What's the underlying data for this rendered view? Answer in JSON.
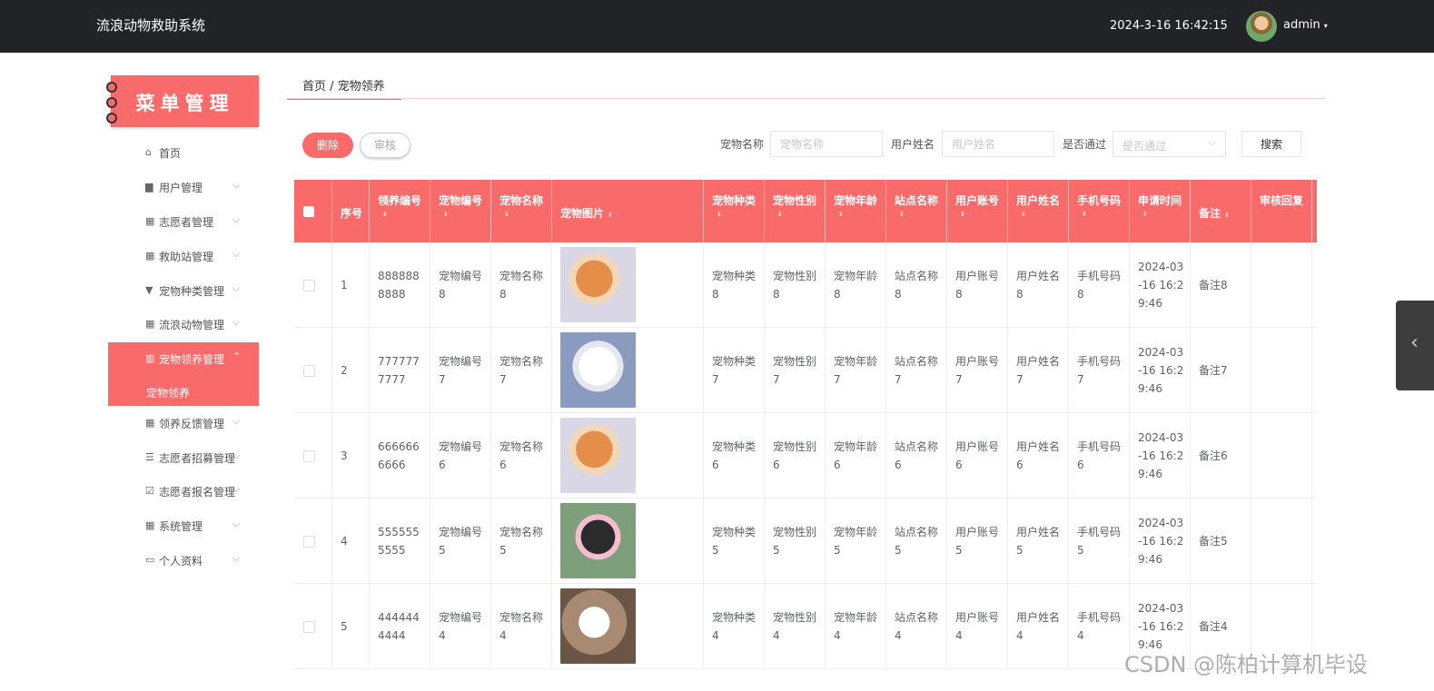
{
  "header": {
    "title": "流浪动物救助系统",
    "datetime": "2024-3-16 16:42:15",
    "username": "admin",
    "caret": "▾"
  },
  "sidebar": {
    "banner": "菜单管理",
    "items": [
      {
        "label": "首页",
        "icon": "⌂",
        "chevron": ""
      },
      {
        "label": "用户管理",
        "icon": "▆",
        "chevron": "⌵"
      },
      {
        "label": "志愿者管理",
        "icon": "▦",
        "chevron": "⌵"
      },
      {
        "label": "救助站管理",
        "icon": "▦",
        "chevron": "⌵"
      },
      {
        "label": "宠物种类管理",
        "icon": "▼",
        "chevron": "⌵"
      },
      {
        "label": "流浪动物管理",
        "icon": "▦",
        "chevron": "⌵"
      },
      {
        "label": "宠物领养管理",
        "icon": "▥",
        "chevron": "⌃"
      },
      {
        "label": "领养反馈管理",
        "icon": "▦",
        "chevron": "⌵"
      },
      {
        "label": "志愿者招募管理",
        "icon": "☰",
        "chevron": "⌵"
      },
      {
        "label": "志愿者报名管理",
        "icon": "☑",
        "chevron": "⌵"
      },
      {
        "label": "系统管理",
        "icon": "▦",
        "chevron": "⌵"
      },
      {
        "label": "个人资料",
        "icon": "▭",
        "chevron": "⌵"
      }
    ],
    "active_sub": "宠物领养"
  },
  "breadcrumb": "首页 / 宠物领养",
  "toolbar": {
    "delete": "删除",
    "audit": "审核",
    "search": "搜索"
  },
  "filters": {
    "pet_name_label": "宠物名称",
    "pet_name_placeholder": "宠物名称",
    "user_name_label": "用户姓名",
    "user_name_placeholder": "用户姓名",
    "passed_label": "是否通过",
    "passed_placeholder": "是否通过",
    "select_chevron": "⌵"
  },
  "table": {
    "sort_glyph": "▲\n▼",
    "sort_glyph_inline": "⇕",
    "headers": [
      "序号",
      "领养编号",
      "宠物编号",
      "宠物名称",
      "宠物图片",
      "宠物种类",
      "宠物性别",
      "宠物年龄",
      "站点名称",
      "用户账号",
      "用户姓名",
      "手机号码",
      "申请时间",
      "备注",
      "审核回复"
    ],
    "rows": [
      {
        "no": "1",
        "adopt_no": "8888888888",
        "pet_no": "宠物编号8",
        "pet_name": "宠物名称8",
        "kind": "宠物种类8",
        "gender": "宠物性别8",
        "age": "宠物年龄8",
        "site": "站点名称8",
        "account": "用户账号8",
        "user": "用户姓名8",
        "phone": "手机号码8",
        "time": "2024-03-16 16:29:46",
        "remark": "备注8",
        "reply": ""
      },
      {
        "no": "2",
        "adopt_no": "7777777777",
        "pet_no": "宠物编号7",
        "pet_name": "宠物名称7",
        "kind": "宠物种类7",
        "gender": "宠物性别7",
        "age": "宠物年龄7",
        "site": "站点名称7",
        "account": "用户账号7",
        "user": "用户姓名7",
        "phone": "手机号码7",
        "time": "2024-03-16 16:29:46",
        "remark": "备注7",
        "reply": ""
      },
      {
        "no": "3",
        "adopt_no": "6666666666",
        "pet_no": "宠物编号6",
        "pet_name": "宠物名称6",
        "kind": "宠物种类6",
        "gender": "宠物性别6",
        "age": "宠物年龄6",
        "site": "站点名称6",
        "account": "用户账号6",
        "user": "用户姓名6",
        "phone": "手机号码6",
        "time": "2024-03-16 16:29:46",
        "remark": "备注6",
        "reply": ""
      },
      {
        "no": "4",
        "adopt_no": "5555555555",
        "pet_no": "宠物编号5",
        "pet_name": "宠物名称5",
        "kind": "宠物种类5",
        "gender": "宠物性别5",
        "age": "宠物年龄5",
        "site": "站点名称5",
        "account": "用户账号5",
        "user": "用户姓名5",
        "phone": "手机号码5",
        "time": "2024-03-16 16:29:46",
        "remark": "备注5",
        "reply": ""
      },
      {
        "no": "5",
        "adopt_no": "4444444444",
        "pet_no": "宠物编号4",
        "pet_name": "宠物名称4",
        "kind": "宠物种类4",
        "gender": "宠物性别4",
        "age": "宠物年龄4",
        "site": "站点名称4",
        "account": "用户账号4",
        "user": "用户姓名4",
        "phone": "手机号码4",
        "time": "2024-03-16 16:29:46",
        "remark": "备注4",
        "reply": ""
      }
    ]
  },
  "side_handle": "‹",
  "watermark": "CSDN @陈柏计算机毕设",
  "colors": {
    "accent": "#f96a6a",
    "topbar": "#222326"
  }
}
